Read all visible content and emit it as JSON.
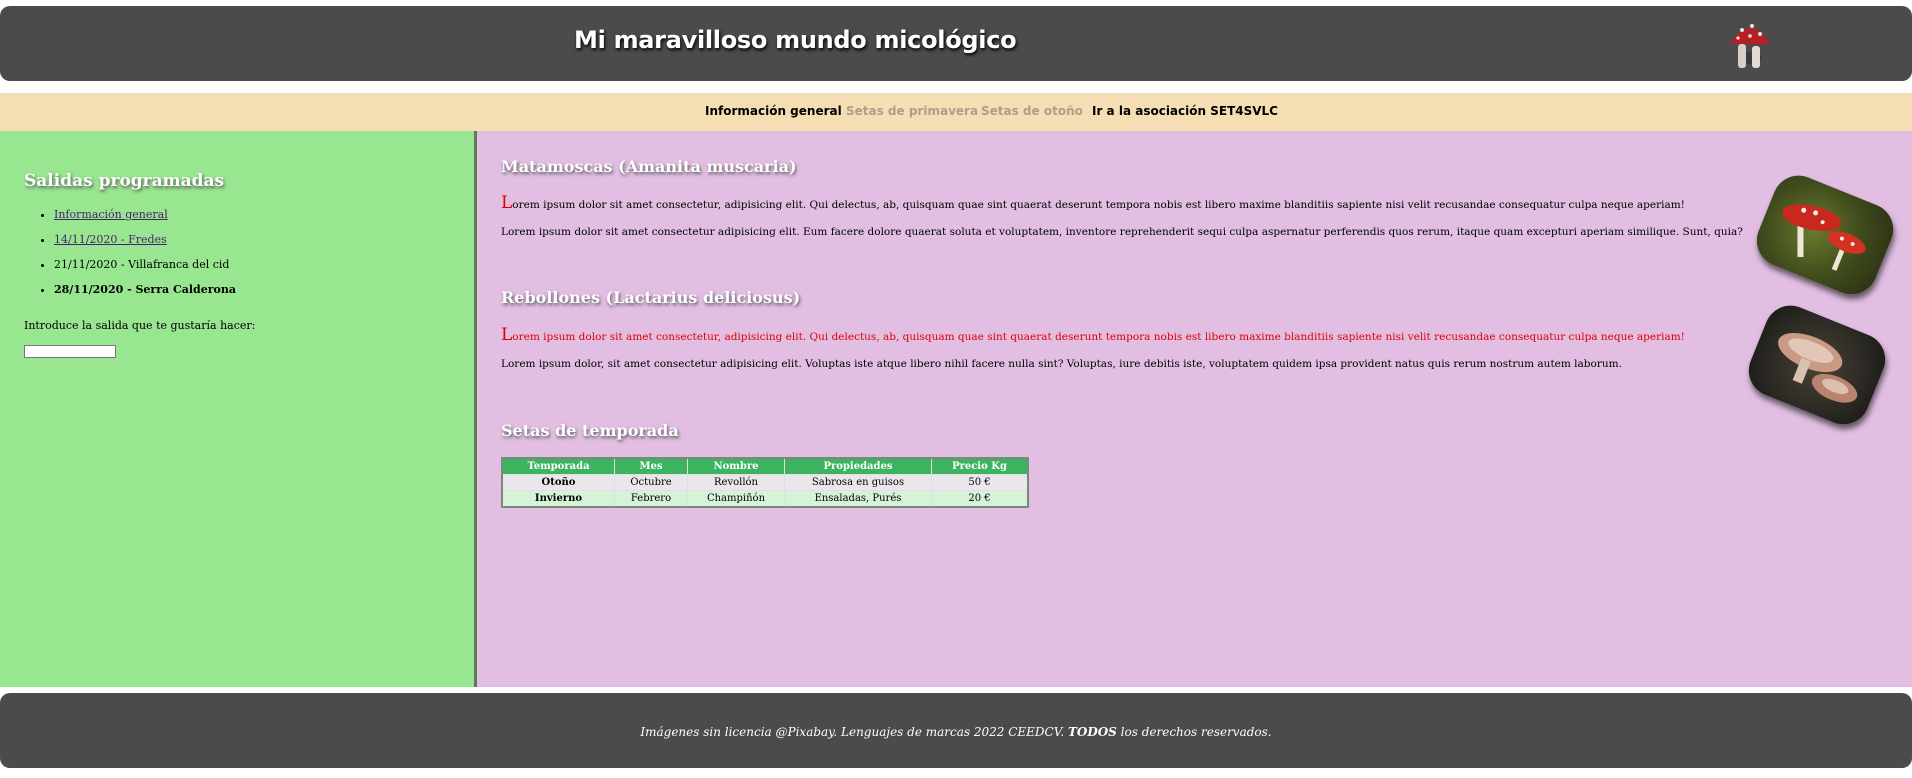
{
  "header": {
    "title": "Mi maravilloso mundo micológico",
    "logo_icon": "mushroom-icon"
  },
  "nav": {
    "items": [
      {
        "label": "Información general"
      },
      {
        "label": "Setas de primavera"
      },
      {
        "label": "Setas de otoño"
      },
      {
        "label": "Ir a la asociación SET4SVLC"
      }
    ]
  },
  "sidebar": {
    "title": "Salidas programadas",
    "items": [
      {
        "label": "Información general"
      },
      {
        "label": "14/11/2020 - Fredes"
      },
      {
        "label": "21/11/2020 - Villafranca del cid"
      },
      {
        "label": "28/11/2020 - Serra Calderona"
      }
    ],
    "prompt": "Introduce la salida que te gustaría hacer:",
    "input_value": ""
  },
  "main": {
    "sections": [
      {
        "title": "Matamoscas (Amanita muscaria)",
        "p1_initial": "L",
        "p1_rest": "orem ipsum dolor sit amet consectetur, adipisicing elit. Qui delectus, ab, quisquam quae sint quaerat deserunt tempora nobis est libero maxime blanditiis sapiente nisi velit recusandae consequatur culpa neque aperiam!",
        "p2": "Lorem ipsum dolor sit amet consectetur adipisicing elit. Eum facere dolore quaerat soluta et voluptatem, inventore reprehenderit sequi culpa aspernatur perferendis quos rerum, itaque quam excepturi aperiam similique. Sunt, quia?"
      },
      {
        "title": "Rebollones (Lactarius deliciosus)",
        "p1_initial": "L",
        "p1_rest": "orem ipsum dolor sit amet consectetur, adipisicing elit. Qui delectus, ab, quisquam quae sint quaerat deserunt tempora nobis est libero maxime blanditiis sapiente nisi velit recusandae consequatur culpa neque aperiam!",
        "p2": "Lorem ipsum dolor, sit amet consectetur adipisicing elit. Voluptas iste atque libero nihil facere nulla sint? Voluptas, iure debitis iste, voluptatem quidem ipsa provident natus quis rerum nostrum autem laborum."
      }
    ],
    "table_title": "Setas de temporada",
    "table": {
      "headers": [
        "Temporada",
        "Mes",
        "Nombre",
        "Propiedades",
        "Precio Kg"
      ],
      "rows": [
        [
          "Otoño",
          "Octubre",
          "Revollón",
          "Sabrosa en guisos",
          "50 €"
        ],
        [
          "Invierno",
          "Febrero",
          "Champiñón",
          "Ensaladas, Purés",
          "20 €"
        ]
      ]
    }
  },
  "footer": {
    "text_before": "Imágenes sin licencia @Pixabay. Lenguajes de marcas 2022 CEEDCV. ",
    "text_bold": "TODOS",
    "text_after": " los derechos reservados."
  },
  "colors": {
    "header_bg": "#4b4b4b",
    "nav_bg": "#f5deb3",
    "sidebar_bg": "#98e690",
    "main_bg": "#e1bee2",
    "table_header": "#3cb45f",
    "accent_red": "#e00000"
  }
}
